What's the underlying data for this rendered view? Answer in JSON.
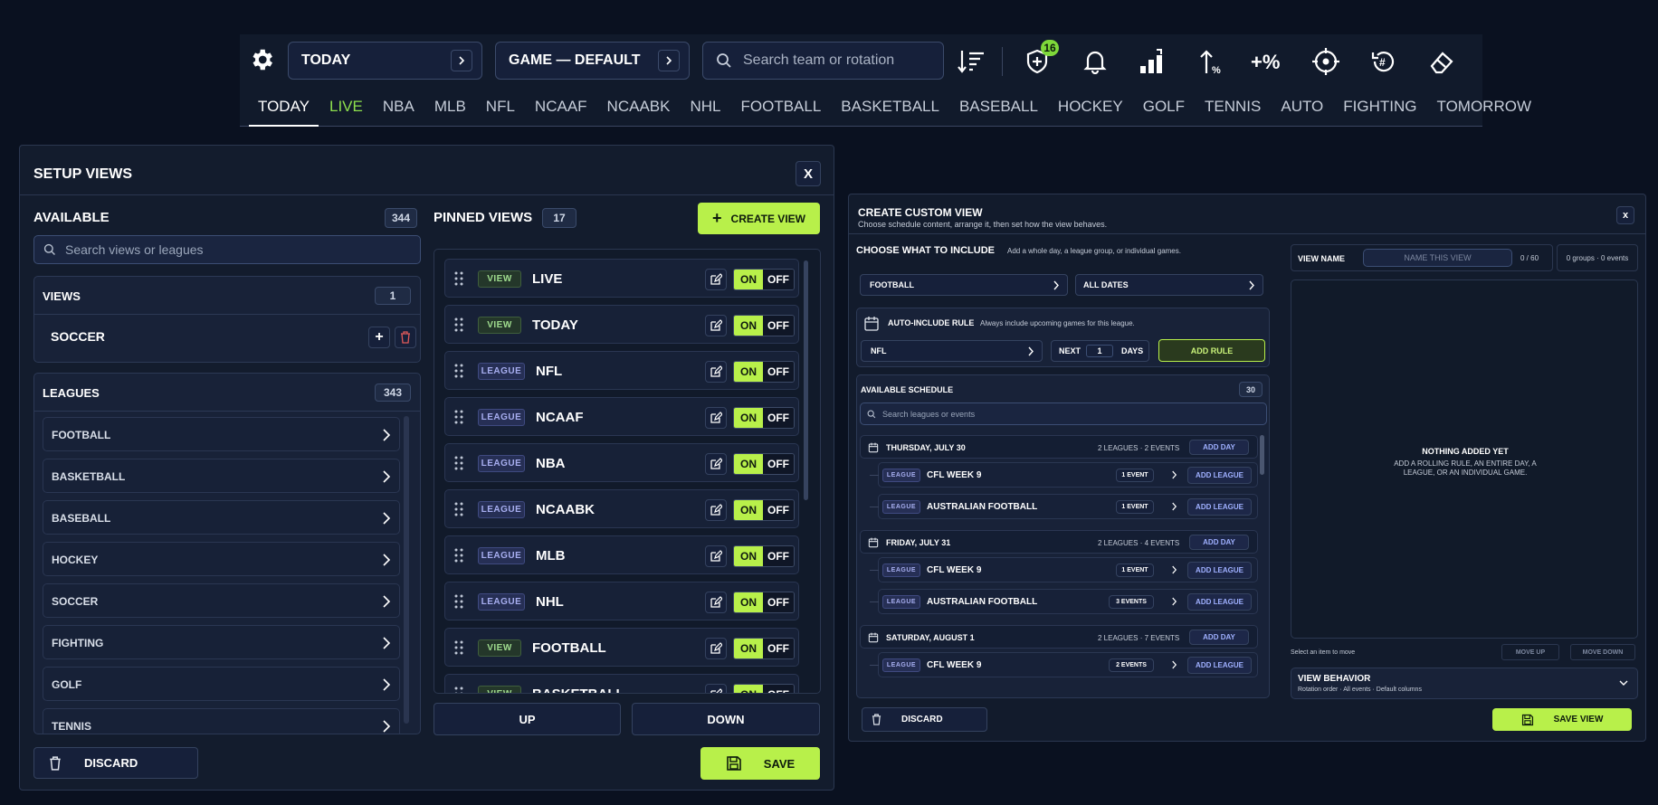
{
  "topbar": {
    "today_label": "TODAY",
    "game_label": "GAME — DEFAULT",
    "search_placeholder": "Search team or rotation",
    "notify_count": "16",
    "tabs": [
      "TODAY",
      "LIVE",
      "NBA",
      "MLB",
      "NFL",
      "NCAAF",
      "NCAABK",
      "NHL",
      "FOOTBALL",
      "BASKETBALL",
      "BASEBALL",
      "HOCKEY",
      "GOLF",
      "TENNIS",
      "AUTO",
      "FIGHTING",
      "TOMORROW"
    ]
  },
  "setup": {
    "title": "SETUP VIEWS",
    "close": "X",
    "available_label": "AVAILABLE",
    "available_count": "344",
    "search_placeholder": "Search views or leagues",
    "views_label": "VIEWS",
    "views_count": "1",
    "view_item": "SOCCER",
    "leagues_label": "LEAGUES",
    "leagues_count": "343",
    "leagues": [
      "FOOTBALL",
      "BASKETBALL",
      "BASEBALL",
      "HOCKEY",
      "SOCCER",
      "FIGHTING",
      "GOLF",
      "TENNIS"
    ],
    "pinned_label": "PINNED VIEWS",
    "pinned_count": "17",
    "create_label": "CREATE VIEW",
    "pinned": [
      {
        "type": "VIEW",
        "name": "LIVE"
      },
      {
        "type": "VIEW",
        "name": "TODAY"
      },
      {
        "type": "LEAGUE",
        "name": "NFL"
      },
      {
        "type": "LEAGUE",
        "name": "NCAAF"
      },
      {
        "type": "LEAGUE",
        "name": "NBA"
      },
      {
        "type": "LEAGUE",
        "name": "NCAABK"
      },
      {
        "type": "LEAGUE",
        "name": "MLB"
      },
      {
        "type": "LEAGUE",
        "name": "NHL"
      },
      {
        "type": "VIEW",
        "name": "FOOTBALL"
      },
      {
        "type": "VIEW",
        "name": "BASKETBALL"
      }
    ],
    "on": "ON",
    "off": "OFF",
    "up": "UP",
    "down": "DOWN",
    "discard": "DISCARD",
    "save": "SAVE"
  },
  "custom": {
    "title": "CREATE CUSTOM VIEW",
    "subtitle": "Choose schedule content, arrange it, then set how the view behaves.",
    "close": "x",
    "choose_label": "CHOOSE WHAT TO INCLUDE",
    "choose_hint": "Add a whole day, a league group, or individual games.",
    "sport_select": "FOOTBALL",
    "date_select": "ALL DATES",
    "rule_label": "AUTO-INCLUDE RULE",
    "rule_hint": "Always include upcoming games for this league.",
    "rule_league": "NFL",
    "next": "NEXT",
    "days_value": "1",
    "days": "DAYS",
    "add_rule": "ADD RULE",
    "schedule_label": "AVAILABLE SCHEDULE",
    "schedule_count": "30",
    "schedule_search": "Search leagues or events",
    "days_list": [
      {
        "date": "THURSDAY, JULY 30",
        "summary": "2 LEAGUES · 2 EVENTS",
        "leagues": [
          {
            "name": "CFL WEEK 9",
            "events": "1 EVENT"
          },
          {
            "name": "AUSTRALIAN FOOTBALL",
            "events": "1 EVENT"
          }
        ]
      },
      {
        "date": "FRIDAY, JULY 31",
        "summary": "2 LEAGUES · 4 EVENTS",
        "leagues": [
          {
            "name": "CFL WEEK 9",
            "events": "1 EVENT"
          },
          {
            "name": "AUSTRALIAN FOOTBALL",
            "events": "3 EVENTS"
          }
        ]
      },
      {
        "date": "SATURDAY, AUGUST 1",
        "summary": "2 LEAGUES · 7 EVENTS",
        "leagues": [
          {
            "name": "CFL WEEK 9",
            "events": "2 EVENTS"
          }
        ]
      }
    ],
    "league_badge": "LEAGUE",
    "add_day": "ADD DAY",
    "add_league": "ADD LEAGUE",
    "view_name_label": "VIEW NAME",
    "view_name_placeholder": "NAME THIS VIEW",
    "name_counter": "0 / 60",
    "groups_summary": "0 groups · 0 events",
    "empty_title": "NOTHING ADDED YET",
    "empty_text": "ADD A ROLLING RULE, AN ENTIRE DAY, A LEAGUE, OR AN INDIVIDUAL GAME.",
    "select_hint": "Select an item to move",
    "move_up": "MOVE UP",
    "move_down": "MOVE DOWN",
    "behavior_label": "VIEW BEHAVIOR",
    "behavior_sub": "Rotation order · All events · Default columns",
    "discard": "DISCARD",
    "save_view": "SAVE VIEW"
  },
  "colors": {
    "accent": "#b8f04a",
    "live": "#8ee04d",
    "bg": "#0a1120"
  }
}
